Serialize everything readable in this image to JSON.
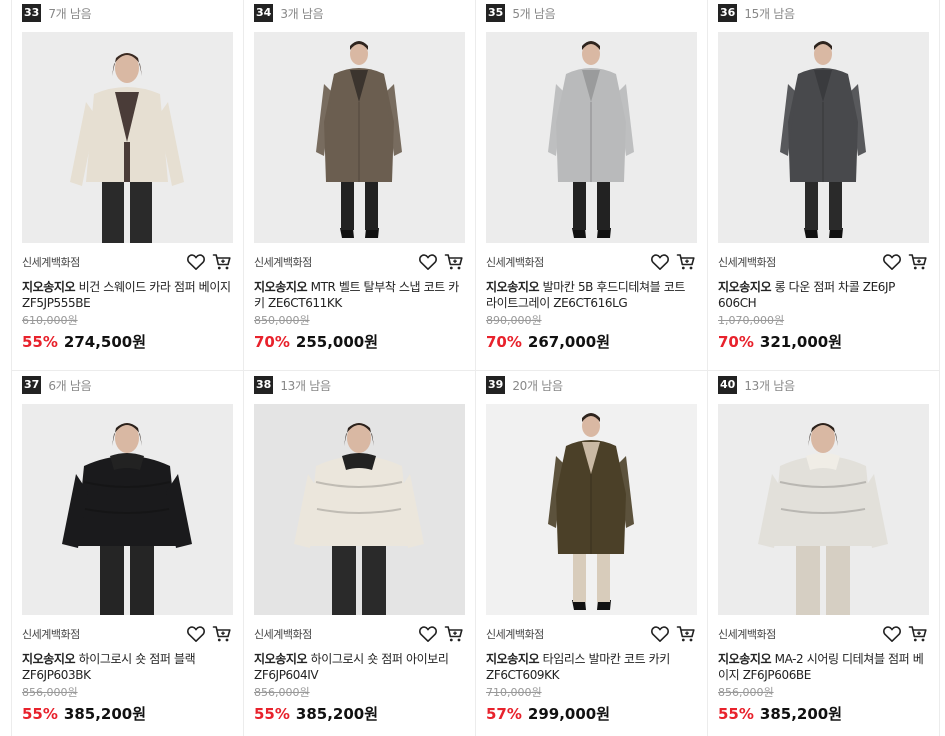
{
  "products": [
    {
      "rank": "33",
      "stock": "7개 남음",
      "store": "신세계백화점",
      "brand": "지오송지오",
      "name": " 비건 스웨이드 카라 점퍼 베이지 ZF5JP555BE",
      "original_price": "610,000원",
      "discount": "55%",
      "price": "274,500원",
      "coat": "#e6dfd2",
      "inner": "#4a3c38",
      "pants": "#2a2a2a",
      "bg": "#ececec",
      "style": "jacket"
    },
    {
      "rank": "34",
      "stock": "3개 남음",
      "store": "신세계백화점",
      "brand": "지오송지오",
      "name": " MTR 벨트 탈부착 스냅 코트 카키 ZE6CT611KK",
      "original_price": "850,000원",
      "discount": "70%",
      "price": "255,000원",
      "coat": "#6b5e50",
      "inner": "#3b342e",
      "pants": "#222222",
      "bg": "#ececec",
      "style": "longcoat"
    },
    {
      "rank": "35",
      "stock": "5개 남음",
      "store": "신세계백화점",
      "brand": "지오송지오",
      "name": " 발마칸 5B 후드디테쳐블 코트 라이트그레이 ZE6CT616LG",
      "original_price": "890,000원",
      "discount": "70%",
      "price": "267,000원",
      "coat": "#b9babb",
      "inner": "#9a9b9c",
      "pants": "#222222",
      "bg": "#ececec",
      "style": "longcoat"
    },
    {
      "rank": "36",
      "stock": "15개 남음",
      "store": "신세계백화점",
      "brand": "지오송지오",
      "name": " 롱 다운 점퍼 차콜 ZE6JP 606CH",
      "original_price": "1,070,000원",
      "discount": "70%",
      "price": "321,000원",
      "coat": "#48494c",
      "inner": "#3a3b3e",
      "pants": "#2a2a2a",
      "bg": "#ececec",
      "style": "longcoat"
    },
    {
      "rank": "37",
      "stock": "6개 남음",
      "store": "신세계백화점",
      "brand": "지오송지오",
      "name": " 하이그로시 숏 점퍼 블랙 ZF6JP603BK",
      "original_price": "856,000원",
      "discount": "55%",
      "price": "385,200원",
      "coat": "#1a1a1c",
      "inner": "#222",
      "pants": "#252525",
      "bg": "#ececec",
      "style": "puffer"
    },
    {
      "rank": "38",
      "stock": "13개 남음",
      "store": "신세계백화점",
      "brand": "지오송지오",
      "name": " 하이그로시 숏 점퍼 아이보리 ZF6JP604IV",
      "original_price": "856,000원",
      "discount": "55%",
      "price": "385,200원",
      "coat": "#ebe6dc",
      "inner": "#222",
      "pants": "#2a2a2a",
      "bg": "#e4e4e4",
      "style": "puffer"
    },
    {
      "rank": "39",
      "stock": "20개 남음",
      "store": "신세계백화점",
      "brand": "지오송지오",
      "name": " 타임리스 발마칸 코트 카키 ZF6CT609KK",
      "original_price": "710,000원",
      "discount": "57%",
      "price": "299,000원",
      "coat": "#4b4028",
      "inner": "#c9b9a4",
      "pants": "#d8ccbb",
      "bg": "#f1f1f1",
      "style": "longcoat"
    },
    {
      "rank": "40",
      "stock": "13개 남음",
      "store": "신세계백화점",
      "brand": "지오송지오",
      "name": " MA-2 시어링 디테쳐블 점퍼 베이지 ZF6JP606BE",
      "original_price": "856,000원",
      "discount": "55%",
      "price": "385,200원",
      "coat": "#e2e0da",
      "inner": "#f0ede6",
      "pants": "#d6cfc3",
      "bg": "#ececec",
      "style": "puffer"
    }
  ],
  "icons": {
    "wishlist": "heart-icon",
    "cart": "cart-icon"
  },
  "colors": {
    "discount": "#e8222c",
    "rank_badge": "#222222"
  }
}
